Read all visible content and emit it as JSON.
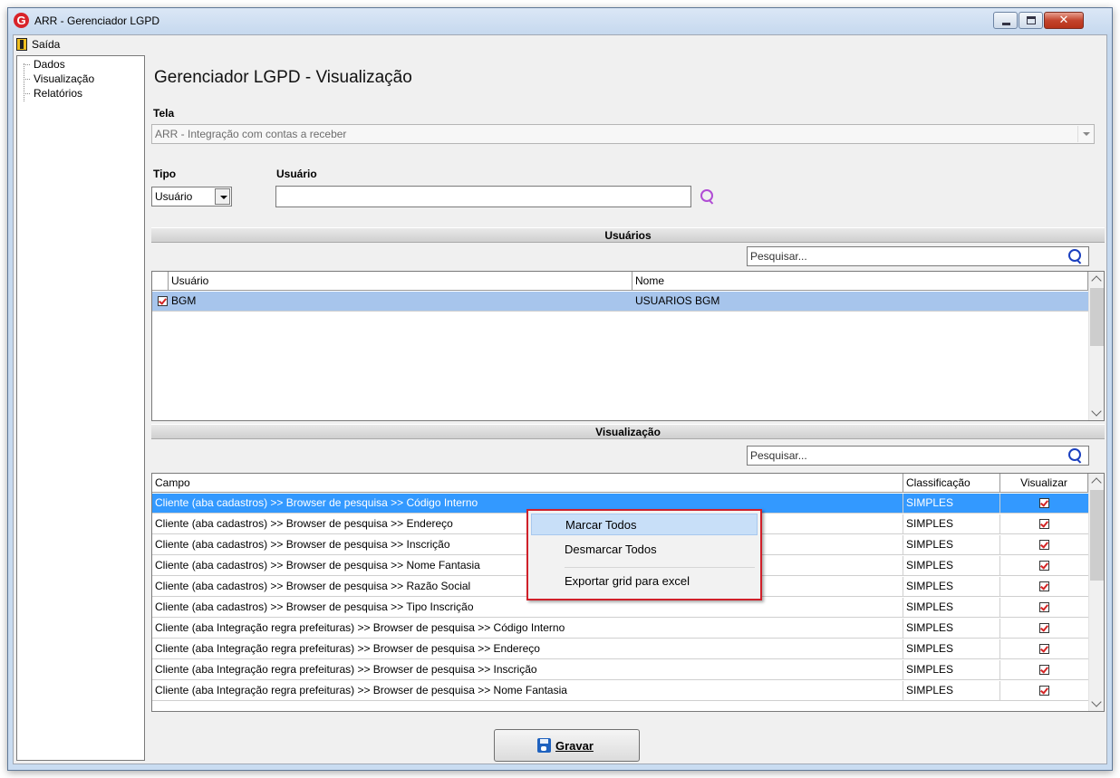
{
  "window": {
    "title": "ARR - Gerenciador LGPD",
    "logo_letter": "G"
  },
  "menu": {
    "exit_label": "Saída"
  },
  "tree": {
    "items": [
      "Dados",
      "Visualização",
      "Relatórios"
    ]
  },
  "page": {
    "title": "Gerenciador LGPD - Visualização"
  },
  "tela": {
    "label": "Tela",
    "value": "ARR - Integração com contas a receber"
  },
  "tipo": {
    "label": "Tipo",
    "value": "Usuário"
  },
  "usuario": {
    "label": "Usuário",
    "value": ""
  },
  "usuarios_section": {
    "title": "Usuários",
    "search_placeholder": "Pesquisar...",
    "columns": [
      "Usuário",
      "Nome"
    ],
    "rows": [
      {
        "usuario": "BGM",
        "nome": "USUARIOS BGM",
        "checked": true
      }
    ]
  },
  "visualizacao_section": {
    "title": "Visualização",
    "search_placeholder": "Pesquisar...",
    "columns": [
      "Campo",
      "Classificação",
      "Visualizar"
    ],
    "rows": [
      {
        "campo": "Cliente (aba cadastros) >> Browser de pesquisa >> Código Interno",
        "classificacao": "SIMPLES",
        "visualizar": true
      },
      {
        "campo": "Cliente (aba cadastros) >> Browser de pesquisa >> Endereço",
        "classificacao": "SIMPLES",
        "visualizar": true
      },
      {
        "campo": "Cliente (aba cadastros) >> Browser de pesquisa >> Inscrição",
        "classificacao": "SIMPLES",
        "visualizar": true
      },
      {
        "campo": "Cliente (aba cadastros) >> Browser de pesquisa >> Nome Fantasia",
        "classificacao": "SIMPLES",
        "visualizar": true
      },
      {
        "campo": "Cliente (aba cadastros) >> Browser de pesquisa >> Razão Social",
        "classificacao": "SIMPLES",
        "visualizar": true
      },
      {
        "campo": "Cliente (aba cadastros) >> Browser de pesquisa >> Tipo Inscrição",
        "classificacao": "SIMPLES",
        "visualizar": true
      },
      {
        "campo": "Cliente (aba Integração regra prefeituras) >> Browser de pesquisa >> Código Interno",
        "classificacao": "SIMPLES",
        "visualizar": true
      },
      {
        "campo": "Cliente (aba Integração regra prefeituras) >> Browser de pesquisa >> Endereço",
        "classificacao": "SIMPLES",
        "visualizar": true
      },
      {
        "campo": "Cliente (aba Integração regra prefeituras) >> Browser de pesquisa >> Inscrição",
        "classificacao": "SIMPLES",
        "visualizar": true
      },
      {
        "campo": "Cliente (aba Integração regra prefeituras) >> Browser de pesquisa >> Nome Fantasia",
        "classificacao": "SIMPLES",
        "visualizar": true
      }
    ]
  },
  "context_menu": {
    "items": [
      "Marcar Todos",
      "Desmarcar Todos",
      "Exportar grid para excel"
    ]
  },
  "actions": {
    "save_label": "Gravar"
  },
  "colors": {
    "selection": "#3399ff",
    "accent_red": "#d0202a",
    "search_icon_purple": "#b04cd4",
    "search_icon_blue": "#1a3fbf"
  }
}
